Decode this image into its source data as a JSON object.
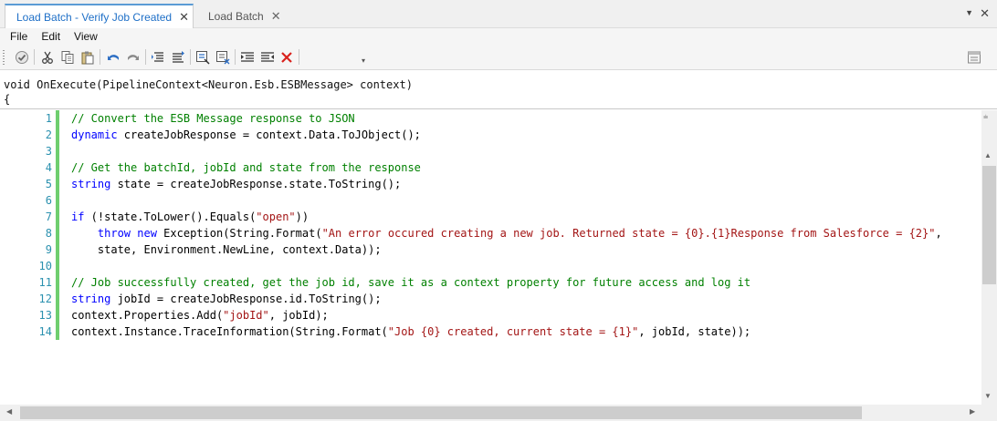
{
  "tabs": [
    {
      "label": "Load Batch - Verify Job Created",
      "close": "✕"
    },
    {
      "label": "Load Batch",
      "close": "✕"
    }
  ],
  "tabstrip": {
    "menu_glyph": "▼",
    "close_glyph": "✕"
  },
  "menu": [
    "File",
    "Edit",
    "View"
  ],
  "toolbar": {
    "icons": [
      "check-icon",
      "cut-icon",
      "copy-icon",
      "paste-icon",
      "undo-icon",
      "redo-icon",
      "indent-list-icon",
      "outdent-list-icon",
      "comment-icon",
      "uncomment-icon",
      "align-left-icon",
      "align-right-icon",
      "delete-icon",
      "overflow-icon"
    ],
    "overflow_glyph": "▾",
    "accent": "#2e6fc4",
    "delete_color": "#d9211c"
  },
  "signature": {
    "line1": "void OnExecute(PipelineContext<Neuron.Esb.ESBMessage> context)",
    "line2": "{"
  },
  "editor": {
    "change_bar_color": "#6fce6f",
    "lines": [
      {
        "n": "1",
        "parts": [
          {
            "t": "// Convert the ESB Message response to JSON",
            "c": "comment"
          }
        ]
      },
      {
        "n": "2",
        "parts": [
          {
            "t": "dynamic",
            "c": "kw"
          },
          {
            "t": " createJobResponse = context.Data.ToJObject();",
            "c": ""
          }
        ]
      },
      {
        "n": "3",
        "parts": []
      },
      {
        "n": "4",
        "parts": [
          {
            "t": "// Get the batchId, jobId and state from the response",
            "c": "comment"
          }
        ]
      },
      {
        "n": "5",
        "parts": [
          {
            "t": "string",
            "c": "kw"
          },
          {
            "t": " state = createJobResponse.state.ToString();",
            "c": ""
          }
        ]
      },
      {
        "n": "6",
        "parts": []
      },
      {
        "n": "7",
        "parts": [
          {
            "t": "if",
            "c": "kw"
          },
          {
            "t": " (!state.ToLower().Equals(",
            "c": ""
          },
          {
            "t": "\"open\"",
            "c": "str"
          },
          {
            "t": "))",
            "c": ""
          }
        ]
      },
      {
        "n": "8",
        "parts": [
          {
            "t": "    ",
            "c": ""
          },
          {
            "t": "throw",
            "c": "kw"
          },
          {
            "t": " ",
            "c": ""
          },
          {
            "t": "new",
            "c": "kw"
          },
          {
            "t": " Exception(String.Format(",
            "c": ""
          },
          {
            "t": "\"An error occured creating a new job. Returned state = {0}.{1}Response from Salesforce = {2}\"",
            "c": "str"
          },
          {
            "t": ",",
            "c": ""
          }
        ]
      },
      {
        "n": "9",
        "parts": [
          {
            "t": "    state, Environment.NewLine, context.Data));",
            "c": ""
          }
        ]
      },
      {
        "n": "10",
        "parts": []
      },
      {
        "n": "11",
        "parts": [
          {
            "t": "// Job successfully created, get the job id, save it as a context property for future access and log it",
            "c": "comment"
          }
        ]
      },
      {
        "n": "12",
        "parts": [
          {
            "t": "string",
            "c": "kw"
          },
          {
            "t": " jobId = createJobResponse.id.ToString();",
            "c": ""
          }
        ]
      },
      {
        "n": "13",
        "parts": [
          {
            "t": "context.Properties.Add(",
            "c": ""
          },
          {
            "t": "\"jobId\"",
            "c": "str"
          },
          {
            "t": ", jobId);",
            "c": ""
          }
        ]
      },
      {
        "n": "14",
        "parts": [
          {
            "t": "context.Instance.TraceInformation(String.Format(",
            "c": ""
          },
          {
            "t": "\"Job {0} created, current state = {1}\"",
            "c": "str"
          },
          {
            "t": ", jobId, state));",
            "c": ""
          }
        ]
      }
    ]
  },
  "scrollbars": {
    "up": "▲",
    "down": "▼",
    "left": "◀",
    "right": "▶",
    "split": "⩧"
  }
}
